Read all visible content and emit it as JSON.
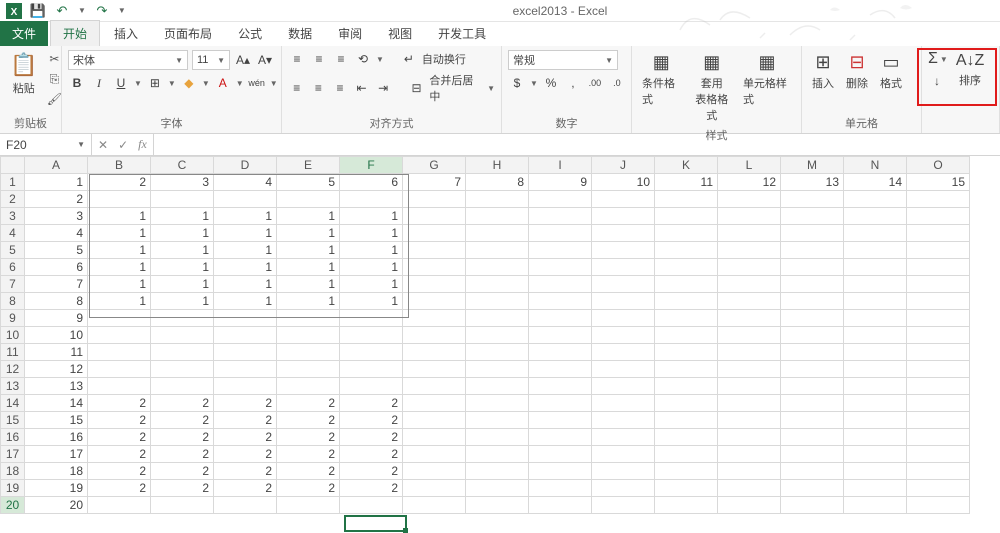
{
  "title": "excel2013 - Excel",
  "qat": {
    "save": "💾",
    "undo": "↶",
    "redo": "↷"
  },
  "tabs": {
    "file": "文件",
    "home": "开始",
    "insert": "插入",
    "layout": "页面布局",
    "formulas": "公式",
    "data": "数据",
    "review": "审阅",
    "view": "视图",
    "dev": "开发工具"
  },
  "ribbon": {
    "clipboard": {
      "label": "剪贴板",
      "paste": "粘贴"
    },
    "font": {
      "label": "字体",
      "name": "宋体",
      "size": "11",
      "bold": "B",
      "italic": "I",
      "underline": "U",
      "wen": "wén"
    },
    "align": {
      "label": "对齐方式",
      "wrap": "自动换行",
      "merge": "合并后居中"
    },
    "number": {
      "label": "数字",
      "format": "常规"
    },
    "styles": {
      "label": "样式",
      "cond": "条件格式",
      "table": "套用\n表格格式",
      "cell": "单元格样式"
    },
    "cells": {
      "label": "单元格",
      "insert": "插入",
      "delete": "删除",
      "format": "格式"
    },
    "editing": {
      "sum": "Σ",
      "fill": "↓",
      "sort": "排序"
    }
  },
  "nameBox": "F20",
  "fx": "fx",
  "cols": [
    "A",
    "B",
    "C",
    "D",
    "E",
    "F",
    "G",
    "H",
    "I",
    "J",
    "K",
    "L",
    "M",
    "N",
    "O"
  ],
  "rows": [
    {
      "n": 1,
      "c": [
        "1",
        "2",
        "3",
        "4",
        "5",
        "6",
        "7",
        "8",
        "9",
        "10",
        "11",
        "12",
        "13",
        "14",
        "15"
      ]
    },
    {
      "n": 2,
      "c": [
        "2",
        "",
        "",
        "",
        "",
        "",
        "",
        "",
        "",
        "",
        "",
        "",
        "",
        "",
        ""
      ]
    },
    {
      "n": 3,
      "c": [
        "3",
        "1",
        "1",
        "1",
        "1",
        "1",
        "",
        "",
        "",
        "",
        "",
        "",
        "",
        "",
        ""
      ]
    },
    {
      "n": 4,
      "c": [
        "4",
        "1",
        "1",
        "1",
        "1",
        "1",
        "",
        "",
        "",
        "",
        "",
        "",
        "",
        "",
        ""
      ]
    },
    {
      "n": 5,
      "c": [
        "5",
        "1",
        "1",
        "1",
        "1",
        "1",
        "",
        "",
        "",
        "",
        "",
        "",
        "",
        "",
        ""
      ]
    },
    {
      "n": 6,
      "c": [
        "6",
        "1",
        "1",
        "1",
        "1",
        "1",
        "",
        "",
        "",
        "",
        "",
        "",
        "",
        "",
        ""
      ]
    },
    {
      "n": 7,
      "c": [
        "7",
        "1",
        "1",
        "1",
        "1",
        "1",
        "",
        "",
        "",
        "",
        "",
        "",
        "",
        "",
        ""
      ]
    },
    {
      "n": 8,
      "c": [
        "8",
        "1",
        "1",
        "1",
        "1",
        "1",
        "",
        "",
        "",
        "",
        "",
        "",
        "",
        "",
        ""
      ]
    },
    {
      "n": 9,
      "c": [
        "9",
        "",
        "",
        "",
        "",
        "",
        "",
        "",
        "",
        "",
        "",
        "",
        "",
        "",
        ""
      ]
    },
    {
      "n": 10,
      "c": [
        "10",
        "",
        "",
        "",
        "",
        "",
        "",
        "",
        "",
        "",
        "",
        "",
        "",
        "",
        ""
      ]
    },
    {
      "n": 11,
      "c": [
        "11",
        "",
        "",
        "",
        "",
        "",
        "",
        "",
        "",
        "",
        "",
        "",
        "",
        "",
        ""
      ]
    },
    {
      "n": 12,
      "c": [
        "12",
        "",
        "",
        "",
        "",
        "",
        "",
        "",
        "",
        "",
        "",
        "",
        "",
        "",
        ""
      ]
    },
    {
      "n": 13,
      "c": [
        "13",
        "",
        "",
        "",
        "",
        "",
        "",
        "",
        "",
        "",
        "",
        "",
        "",
        "",
        ""
      ]
    },
    {
      "n": 14,
      "c": [
        "14",
        "2",
        "2",
        "2",
        "2",
        "2",
        "",
        "",
        "",
        "",
        "",
        "",
        "",
        "",
        ""
      ]
    },
    {
      "n": 15,
      "c": [
        "15",
        "2",
        "2",
        "2",
        "2",
        "2",
        "",
        "",
        "",
        "",
        "",
        "",
        "",
        "",
        ""
      ]
    },
    {
      "n": 16,
      "c": [
        "16",
        "2",
        "2",
        "2",
        "2",
        "2",
        "",
        "",
        "",
        "",
        "",
        "",
        "",
        "",
        ""
      ]
    },
    {
      "n": 17,
      "c": [
        "17",
        "2",
        "2",
        "2",
        "2",
        "2",
        "",
        "",
        "",
        "",
        "",
        "",
        "",
        "",
        ""
      ]
    },
    {
      "n": 18,
      "c": [
        "18",
        "2",
        "2",
        "2",
        "2",
        "2",
        "",
        "",
        "",
        "",
        "",
        "",
        "",
        "",
        ""
      ]
    },
    {
      "n": 19,
      "c": [
        "19",
        "2",
        "2",
        "2",
        "2",
        "2",
        "",
        "",
        "",
        "",
        "",
        "",
        "",
        "",
        ""
      ]
    },
    {
      "n": 20,
      "c": [
        "20",
        "",
        "",
        "",
        "",
        "",
        "",
        "",
        "",
        "",
        "",
        "",
        "",
        "",
        ""
      ]
    }
  ],
  "activeCell": {
    "row": 20,
    "col": "F"
  },
  "activeColIndex": 5
}
